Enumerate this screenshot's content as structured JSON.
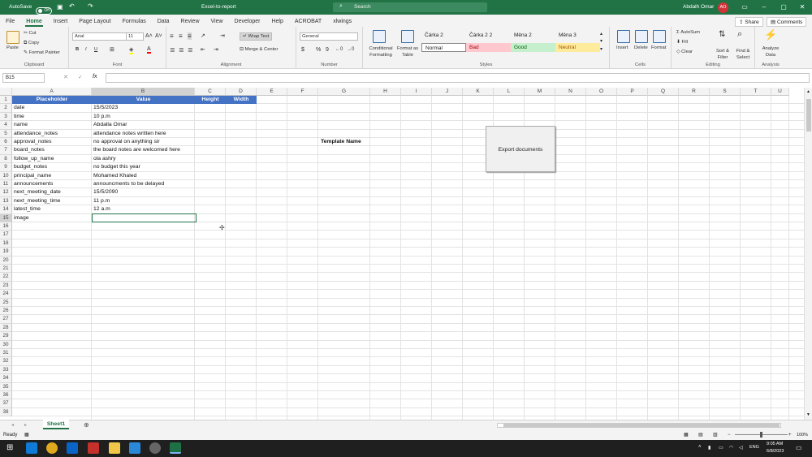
{
  "titlebar": {
    "autosave_label": "AutoSave",
    "autosave_state": "Off",
    "file_name": "Excel-to-report",
    "search_placeholder": "Search",
    "user_name": "Abdalh Omar",
    "user_initials": "AO"
  },
  "menu": [
    "File",
    "Home",
    "Insert",
    "Page Layout",
    "Formulas",
    "Data",
    "Review",
    "View",
    "Developer",
    "Help",
    "ACROBAT",
    "xlwings"
  ],
  "share_label": "Share",
  "comments_label": "Comments",
  "ribbon": {
    "clipboard": {
      "paste": "Paste",
      "cut": "Cut",
      "copy": "Copy",
      "format_painter": "Format Painter",
      "group": "Clipboard"
    },
    "font": {
      "name": "Arial",
      "size": "11",
      "bold": "B",
      "italic": "I",
      "underline": "U",
      "group": "Font"
    },
    "alignment": {
      "wrap": "Wrap Text",
      "merge": "Merge & Center",
      "group": "Alignment"
    },
    "number": {
      "format": "General",
      "group": "Number"
    },
    "styles": {
      "conditional": "Conditional Formatting",
      "format_table": "Format as Table",
      "group": "Styles",
      "cells": [
        {
          "label": "Čárka 2",
          "bg": "#ffffff",
          "color": "#222222"
        },
        {
          "label": "Čárka 2 2",
          "bg": "#ffffff",
          "color": "#222222"
        },
        {
          "label": "Měna 2",
          "bg": "#ffffff",
          "color": "#222222"
        },
        {
          "label": "Měna 3",
          "bg": "#ffffff",
          "color": "#222222"
        },
        {
          "label": "Normal",
          "bg": "#ffffff",
          "color": "#222222"
        },
        {
          "label": "Bad",
          "bg": "#ffc7ce",
          "color": "#9c0006"
        },
        {
          "label": "Good",
          "bg": "#c6efce",
          "color": "#006100"
        },
        {
          "label": "Neutral",
          "bg": "#ffeb9c",
          "color": "#9c5700"
        }
      ]
    },
    "cells": {
      "insert": "Insert",
      "delete": "Delete",
      "format": "Format",
      "group": "Cells"
    },
    "editing": {
      "autosum": "AutoSum",
      "fill": "Fill",
      "clear": "Clear",
      "sort": "Sort & Filter",
      "find": "Find & Select",
      "group": "Editing"
    },
    "analysis": {
      "analyze": "Analyze Data",
      "group": "Analysis"
    }
  },
  "formula_bar": {
    "name_box": "B15",
    "fx": "fx",
    "value": ""
  },
  "columns": [
    "A",
    "B",
    "C",
    "D",
    "E",
    "F",
    "G",
    "H",
    "I",
    "J",
    "K",
    "L",
    "M",
    "N",
    "O",
    "P",
    "Q",
    "R",
    "S",
    "T",
    "U"
  ],
  "table_headers": [
    "Placeholder",
    "Value",
    "Height",
    "Width"
  ],
  "rows": [
    {
      "placeholder": "date",
      "value": "15/5/2023"
    },
    {
      "placeholder": "time",
      "value": "10 p.m"
    },
    {
      "placeholder": "name",
      "value": "Abdalla Omar"
    },
    {
      "placeholder": "attendance_notes",
      "value": "attendance notes written here"
    },
    {
      "placeholder": "approval_notes",
      "value": "no approval on anything sir"
    },
    {
      "placeholder": "board_notes",
      "value": "the board notes are welcomed here"
    },
    {
      "placeholder": "follow_up_name",
      "value": "ola ashry"
    },
    {
      "placeholder": "budget_notes",
      "value": "no budget this year"
    },
    {
      "placeholder": "principal_name",
      "value": "Mohamed Khaled"
    },
    {
      "placeholder": "announcements",
      "value": "announcments to be delayed"
    },
    {
      "placeholder": "next_meeting_date",
      "value": "15/5/2090"
    },
    {
      "placeholder": "next_meeting_time",
      "value": "11 p.m"
    },
    {
      "placeholder": "latest_time",
      "value": "12 a.m"
    },
    {
      "placeholder": "image",
      "value": ""
    }
  ],
  "template_name_label": "Template Name",
  "export_button": "Export documents",
  "sheet_tab": "Sheet1",
  "status": {
    "ready": "Ready",
    "zoom": "100%"
  },
  "taskbar": {
    "lang": "ENG",
    "time": "9:05 AM",
    "date": "6/8/2023"
  },
  "colors": {
    "excel_green": "#217346",
    "header_blue": "#4472c4"
  }
}
